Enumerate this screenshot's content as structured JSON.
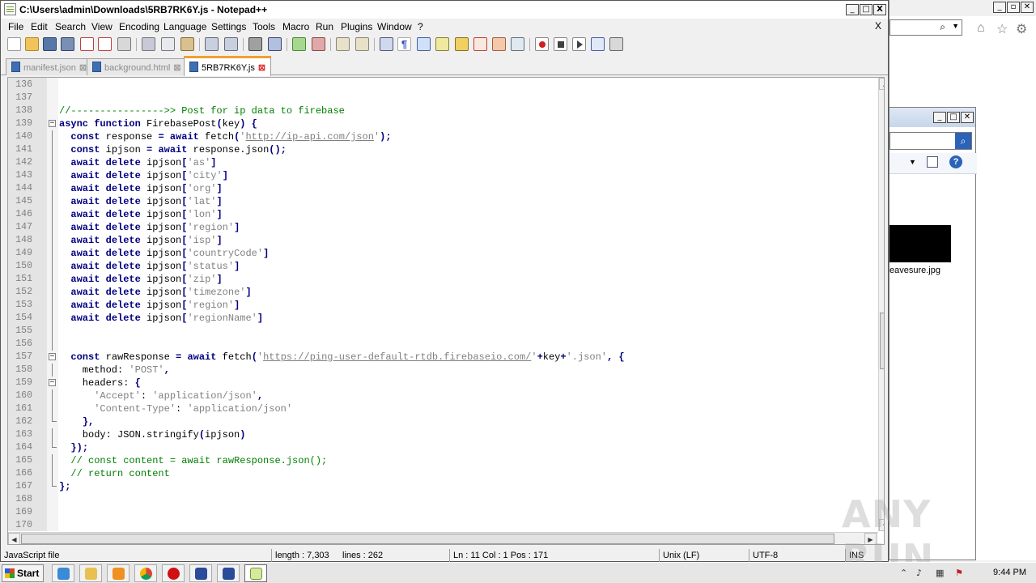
{
  "window": {
    "title": "C:\\Users\\admin\\Downloads\\5RB7RK6Y.js - Notepad++",
    "controls": {
      "minimize": "_",
      "maximize": "□",
      "close": "X"
    }
  },
  "menu": [
    "File",
    "Edit",
    "Search",
    "View",
    "Encoding",
    "Language",
    "Settings",
    "Tools",
    "Macro",
    "Run",
    "Plugins",
    "Window",
    "?"
  ],
  "menu_close": "X",
  "toolbar_icons": [
    "new-file-icon",
    "open-file-icon",
    "save-icon",
    "save-all-icon",
    "close-icon",
    "close-all-icon",
    "print-icon",
    "cut-icon",
    "copy-icon",
    "paste-icon",
    "undo-icon",
    "redo-icon",
    "find-icon",
    "replace-icon",
    "zoom-in-icon",
    "zoom-out-icon",
    "sync-v-icon",
    "sync-h-icon",
    "word-wrap-icon",
    "show-all-chars-icon",
    "indent-guide-icon",
    "doc-map-icon",
    "function-list-icon",
    "folder-workspace-icon",
    "monitoring-icon",
    "record-macro-icon",
    "stop-record-icon",
    "playback-icon",
    "run-macro-multiple-icon",
    "save-macro-icon"
  ],
  "tabs": [
    {
      "label": "manifest.json",
      "active": false
    },
    {
      "label": "background.html",
      "active": false
    },
    {
      "label": "5RB7RK6Y.js",
      "active": true
    }
  ],
  "code_lines": [
    {
      "n": "136",
      "t": ""
    },
    {
      "n": "137",
      "t": ""
    },
    {
      "n": "138",
      "t": "//---------------->> Post for ip data to firebase"
    },
    {
      "n": "139",
      "t": "async function FirebasePost(key) {"
    },
    {
      "n": "140",
      "t": "  const response = await fetch('http://ip-api.com/json');"
    },
    {
      "n": "141",
      "t": "  const ipjson = await response.json();"
    },
    {
      "n": "142",
      "t": "  await delete ipjson['as']"
    },
    {
      "n": "143",
      "t": "  await delete ipjson['city']"
    },
    {
      "n": "144",
      "t": "  await delete ipjson['org']"
    },
    {
      "n": "145",
      "t": "  await delete ipjson['lat']"
    },
    {
      "n": "146",
      "t": "  await delete ipjson['lon']"
    },
    {
      "n": "147",
      "t": "  await delete ipjson['region']"
    },
    {
      "n": "148",
      "t": "  await delete ipjson['isp']"
    },
    {
      "n": "149",
      "t": "  await delete ipjson['countryCode']"
    },
    {
      "n": "150",
      "t": "  await delete ipjson['status']"
    },
    {
      "n": "151",
      "t": "  await delete ipjson['zip']"
    },
    {
      "n": "152",
      "t": "  await delete ipjson['timezone']"
    },
    {
      "n": "153",
      "t": "  await delete ipjson['region']"
    },
    {
      "n": "154",
      "t": "  await delete ipjson['regionName']"
    },
    {
      "n": "155",
      "t": ""
    },
    {
      "n": "156",
      "t": ""
    },
    {
      "n": "157",
      "t": "  const rawResponse = await fetch('https://ping-user-default-rtdb.firebaseio.com/'+key+'.json', {"
    },
    {
      "n": "158",
      "t": "    method: 'POST',"
    },
    {
      "n": "159",
      "t": "    headers: {"
    },
    {
      "n": "160",
      "t": "      'Accept': 'application/json',"
    },
    {
      "n": "161",
      "t": "      'Content-Type': 'application/json'"
    },
    {
      "n": "162",
      "t": "    },"
    },
    {
      "n": "163",
      "t": "    body: JSON.stringify(ipjson)"
    },
    {
      "n": "164",
      "t": "  });"
    },
    {
      "n": "165",
      "t": "  // const content = await rawResponse.json();"
    },
    {
      "n": "166",
      "t": "  // return content"
    },
    {
      "n": "167",
      "t": "};"
    },
    {
      "n": "168",
      "t": ""
    },
    {
      "n": "169",
      "t": ""
    },
    {
      "n": "170",
      "t": ""
    }
  ],
  "status": {
    "file_type": "JavaScript file",
    "length": "length : 7,303",
    "lines": "lines : 262",
    "position": "Ln : 11    Col : 1    Pos : 171",
    "eol": "Unix (LF)",
    "encoding": "UTF-8",
    "mode": "INS"
  },
  "background": {
    "explorer_file": "eavesure.jpg"
  },
  "taskbar": {
    "start": "Start",
    "clock": "9:44 PM",
    "apps": [
      "ie-icon",
      "explorer-icon",
      "media-player-icon",
      "chrome-icon",
      "opera-icon",
      "powershell-icon",
      "powershell-icon",
      "notepadpp-icon"
    ]
  },
  "watermark": "ANY RUN",
  "colors": {
    "keyword": "#000080",
    "comment": "#008000",
    "string": "#808080",
    "tab_accent": "#f0a030"
  }
}
